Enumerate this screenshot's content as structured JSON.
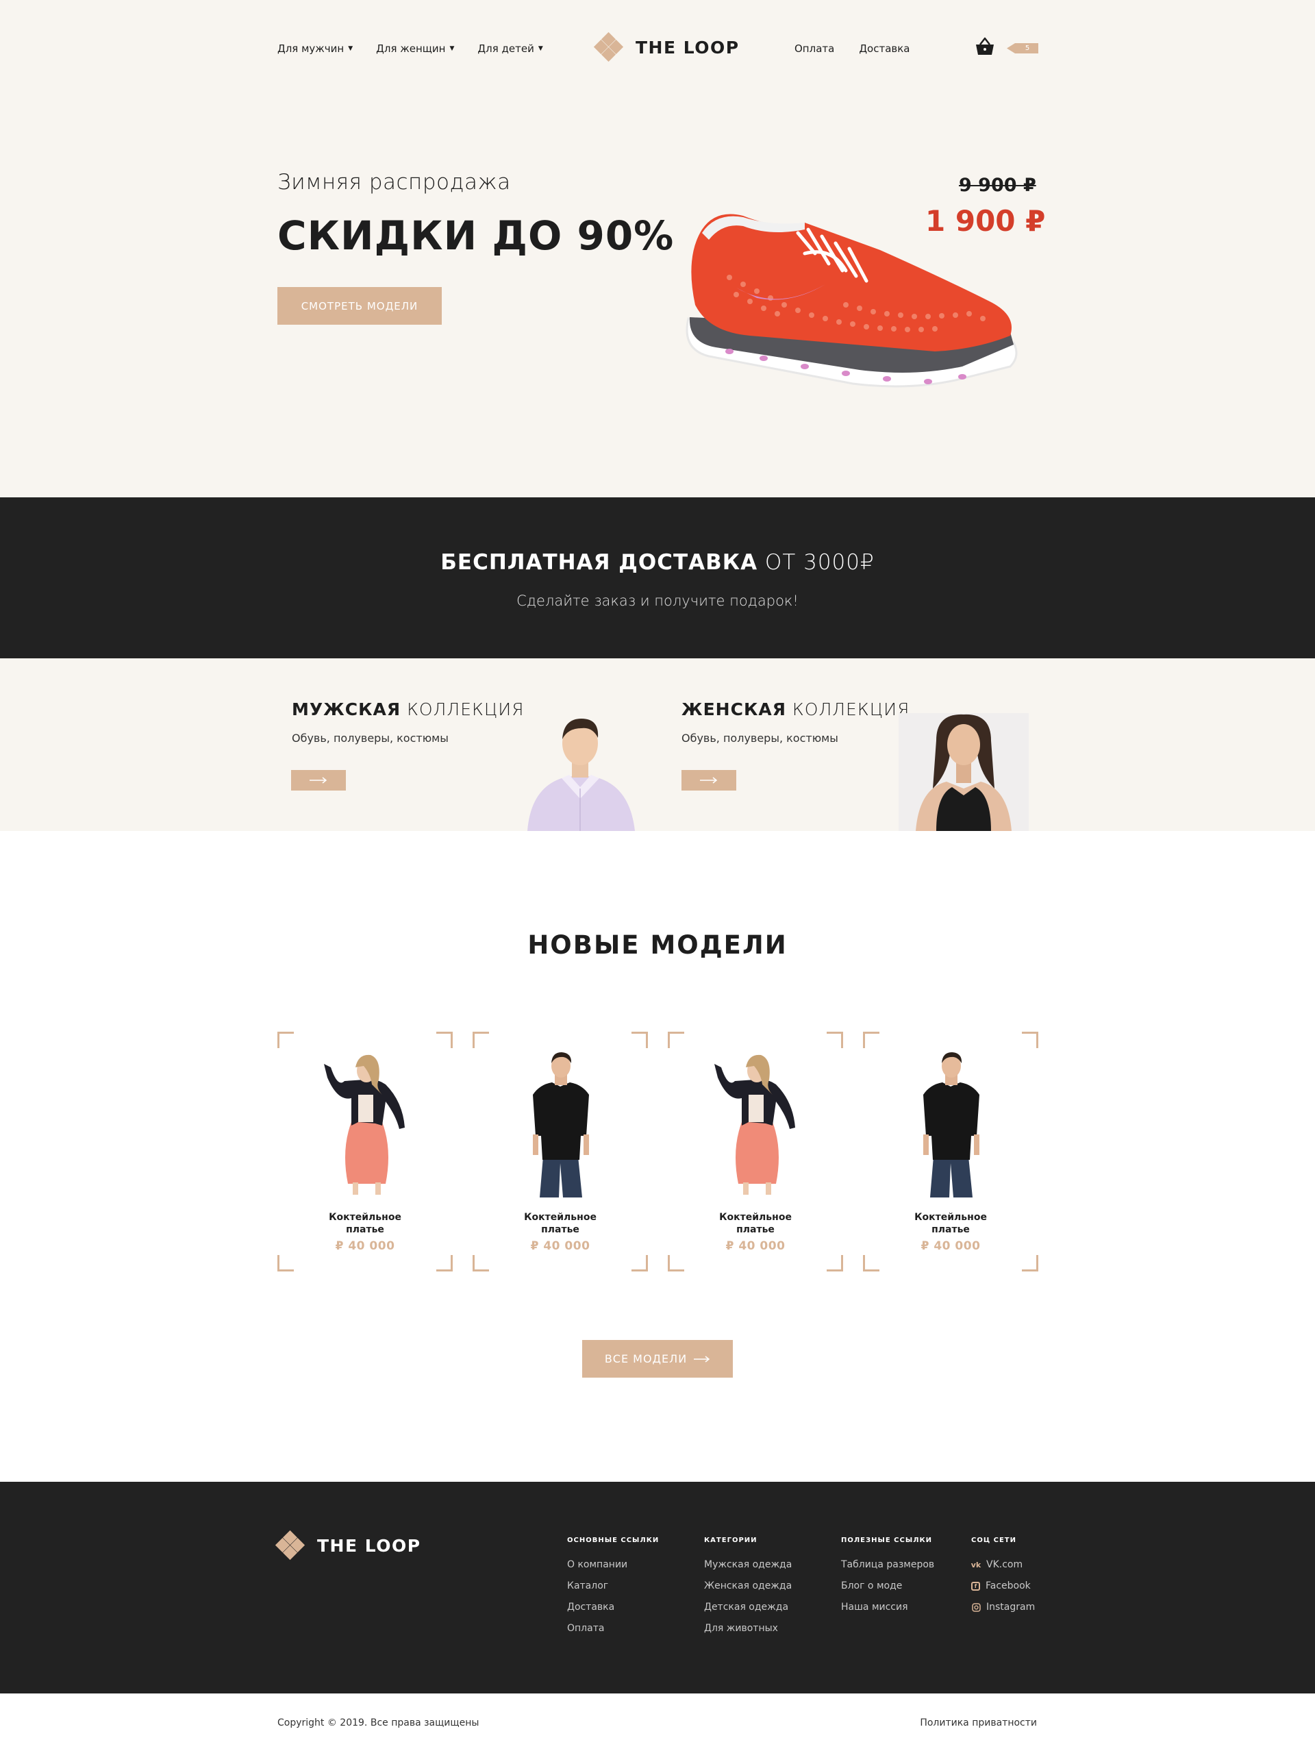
{
  "header": {
    "nav_left": [
      {
        "label": "Для мужчин"
      },
      {
        "label": "Для женщин"
      },
      {
        "label": "Для детей"
      }
    ],
    "logo_text": "THE LOOP",
    "nav_right": [
      {
        "label": "Оплата"
      },
      {
        "label": "Доставка"
      }
    ],
    "cart_count": "5"
  },
  "hero": {
    "subtitle": "Зимняя распродажа",
    "title": "СКИДКИ ДО 90%",
    "button": "СМОТРЕТЬ МОДЕЛИ",
    "old_price": "9 900 ₽",
    "new_price": "1 900 ₽"
  },
  "delivery": {
    "title_bold": "БЕСПЛАТНАЯ ДОСТАВКА",
    "title_rest": " ОТ 3000₽",
    "text": "Сделайте заказ и получите подарок!"
  },
  "collections": [
    {
      "title_bold": "МУЖСКАЯ",
      "title_rest": " КОЛЛЕКЦИЯ",
      "desc": "Обувь, полуверы, костюмы"
    },
    {
      "title_bold": "ЖЕНСКАЯ",
      "title_rest": " КОЛЛЕКЦИЯ",
      "desc": "Обувь, полуверы, костюмы"
    }
  ],
  "models": {
    "title": "НОВЫЕ МОДЕЛИ",
    "items": [
      {
        "name": "Коктейльное платье",
        "price": "₽ 40 000"
      },
      {
        "name": "Коктейльное платье",
        "price": "₽ 40 000"
      },
      {
        "name": "Коктейльное платье",
        "price": "₽ 40 000"
      },
      {
        "name": "Коктейльное платье",
        "price": "₽ 40 000"
      }
    ],
    "all_button": "ВСЕ МОДЕЛИ"
  },
  "footer": {
    "logo_text": "THE LOOP",
    "columns": [
      {
        "heading": "ОСНОВНЫЕ ССЫЛКИ",
        "links": [
          "О компании",
          "Каталог",
          "Доставка",
          "Оплата"
        ]
      },
      {
        "heading": "КАТЕГОРИИ",
        "links": [
          "Мужская одежда",
          "Женская одежда",
          "Детская одежда",
          "Для животных"
        ]
      },
      {
        "heading": "ПОЛЕЗНЫЕ ССЫЛКИ",
        "links": [
          "Таблица размеров",
          "Блог о моде",
          "Наша миссия"
        ]
      },
      {
        "heading": "СОЦ СЕТИ",
        "links": [
          "VK.com",
          "Facebook",
          "Instagram"
        ]
      }
    ],
    "social_icons": [
      "vk-icon",
      "facebook-icon",
      "instagram-icon"
    ]
  },
  "bottom": {
    "copyright": "Copyright © 2019. Все права защищены",
    "privacy": "Политика приватности"
  },
  "colors": {
    "accent": "#d9b597",
    "sale_red": "#d43e2a",
    "dark": "#222222",
    "cream": "#f8f5f0"
  }
}
